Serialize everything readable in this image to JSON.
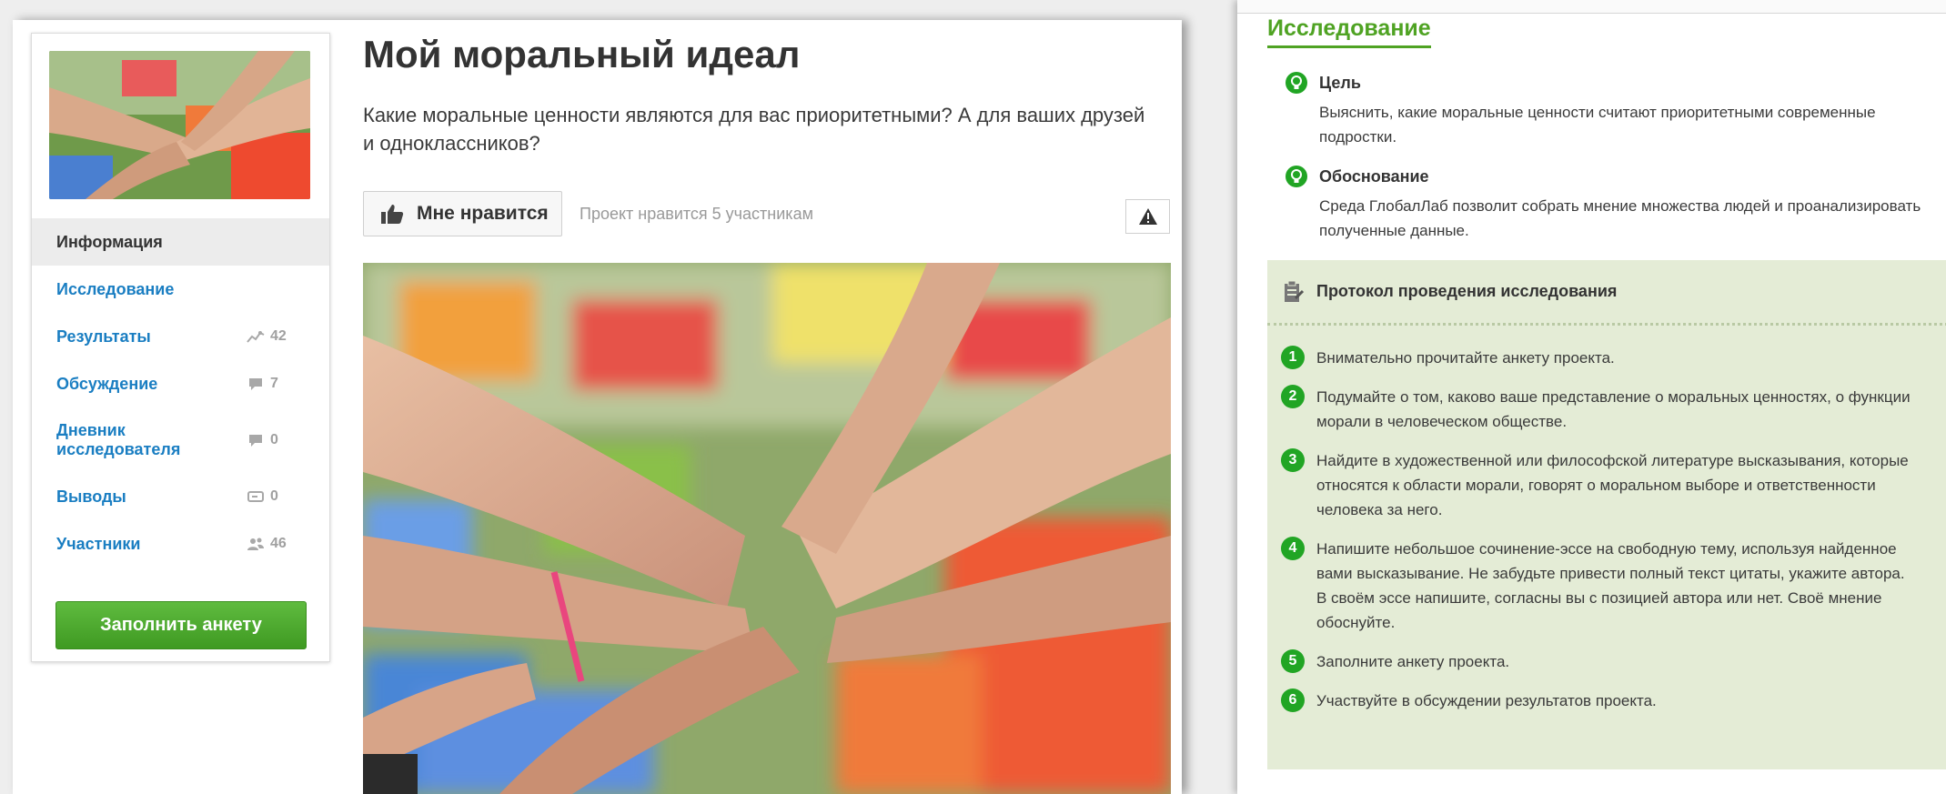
{
  "project": {
    "title": "Мой моральный идеал",
    "intro": "Какие моральные ценности являются для вас приоритетными? А для ваших друзей и одноклассников?",
    "like_button": "Мне нравится",
    "likes_note": "Проект нравится 5 участникам"
  },
  "sidebar": {
    "items": [
      {
        "label": "Информация",
        "count": "",
        "icon": ""
      },
      {
        "label": "Исследование",
        "count": "",
        "icon": ""
      },
      {
        "label": "Результаты",
        "count": "42",
        "icon": "chart-icon"
      },
      {
        "label": "Обсуждение",
        "count": "7",
        "icon": "comment-icon"
      },
      {
        "label": "Дневник исследователя",
        "count": "0",
        "icon": "comment-icon"
      },
      {
        "label": "Выводы",
        "count": "0",
        "icon": "conclusion-icon"
      },
      {
        "label": "Участники",
        "count": "46",
        "icon": "users-icon"
      }
    ],
    "fill_button": "Заполнить анкету"
  },
  "research": {
    "title": "Исследование",
    "goal_title": "Цель",
    "goal_lines": [
      "Выяснить, какие моральные ценности считают приоритетными современные",
      "подростки."
    ],
    "reason_title": "Обоснование",
    "reason_lines": [
      "Среда ГлобалЛаб позволит собрать мнение множества людей и проанализировать",
      "полученные данные."
    ],
    "protocol_title": "Протокол проведения исследования",
    "steps": [
      {
        "num": "1",
        "lines": [
          "Внимательно прочитайте анкету проекта."
        ]
      },
      {
        "num": "2",
        "lines": [
          "Подумайте о том, каково ваше представление о моральных ценностях, о функции",
          "морали в человеческом обществе."
        ]
      },
      {
        "num": "3",
        "lines": [
          "Найдите в художественной или философской литературе высказывания, которые",
          "относятся к области морали, говорят о моральном выборе и ответственности",
          "человека за него."
        ]
      },
      {
        "num": "4",
        "lines": [
          "Напишите небольшое сочинение-эссе на свободную тему, используя найденное",
          "вами высказывание. Не забудьте привести полный текст цитаты, укажите автора.",
          "В своём эссе напишите, согласны вы с позицией автора или нет. Своё мнение",
          "обоснуйте."
        ]
      },
      {
        "num": "5",
        "lines": [
          "Заполните анкету проекта."
        ]
      },
      {
        "num": "6",
        "lines": [
          "Участвуйте в обсуждении результатов проекта."
        ]
      }
    ]
  },
  "colors": {
    "link": "#1a7ec2",
    "accent_green": "#4fa323",
    "step_badge": "#21a524",
    "protocol_bg": "#e4ecd6"
  }
}
